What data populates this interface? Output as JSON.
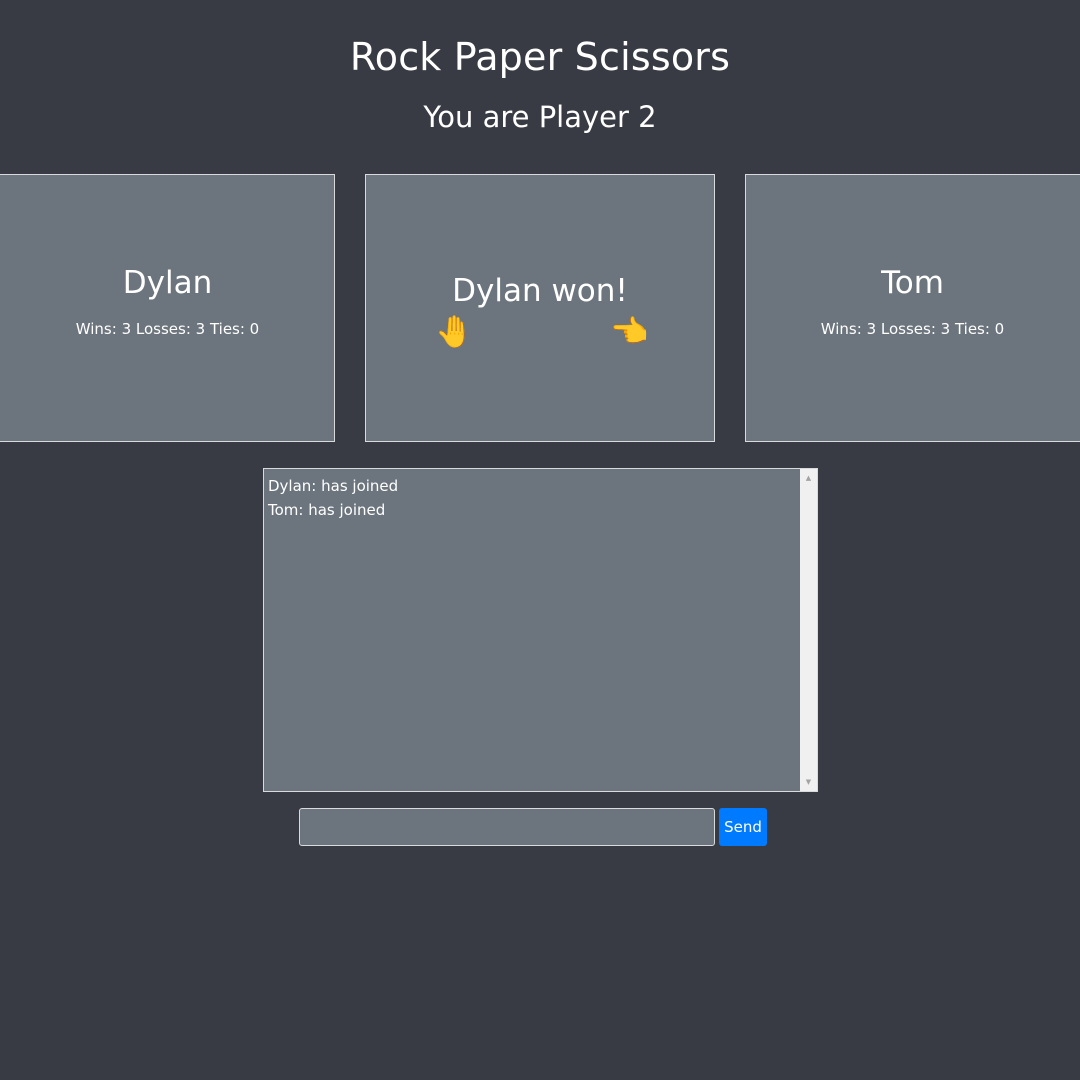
{
  "header": {
    "title": "Rock Paper Scissors",
    "subtitle": "You are Player 2"
  },
  "players": [
    {
      "name": "Dylan",
      "stats": "Wins: 3 Losses: 3 Ties: 0"
    },
    {
      "name": "Tom",
      "stats": "Wins: 3 Losses: 3 Ties: 0"
    }
  ],
  "result": {
    "text": "Dylan won!",
    "left_choice_icon": "raised-back-of-hand-icon",
    "left_choice_glyph": "🤚",
    "right_choice_icon": "backhand-index-pointing-left-icon",
    "right_choice_glyph": "👈"
  },
  "chat": {
    "messages": [
      "Dylan: has joined",
      "Tom: has joined"
    ]
  },
  "message_input": {
    "value": "",
    "placeholder": ""
  },
  "send_button": {
    "label": "Send"
  },
  "colors": {
    "background": "#383b43",
    "card": "#6c757d",
    "accent": "#007bff",
    "icon": "#f7c31a"
  }
}
